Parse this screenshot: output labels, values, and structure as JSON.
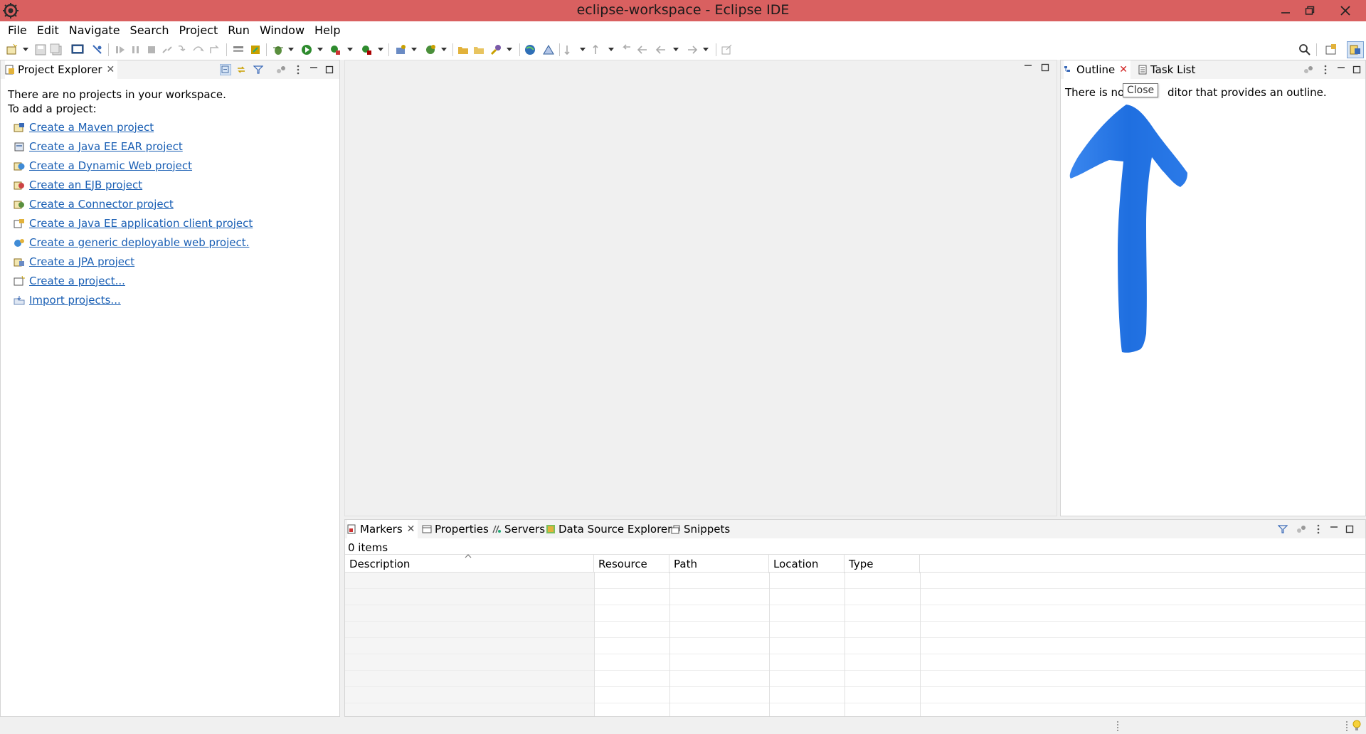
{
  "window": {
    "title": "eclipse-workspace - Eclipse IDE",
    "accent_color": "#d96060"
  },
  "menu": [
    "File",
    "Edit",
    "Navigate",
    "Search",
    "Project",
    "Run",
    "Window",
    "Help"
  ],
  "project_explorer": {
    "tab_label": "Project Explorer",
    "message_line1": "There are no projects in your workspace.",
    "message_line2": "To add a project:",
    "links": [
      {
        "label": "Create a Maven project",
        "icon": "maven-project-icon"
      },
      {
        "label": "Create a Java EE EAR project",
        "icon": "ear-project-icon"
      },
      {
        "label": "Create a Dynamic Web project",
        "icon": "web-project-icon"
      },
      {
        "label": "Create an EJB project",
        "icon": "ejb-project-icon"
      },
      {
        "label": "Create a Connector project",
        "icon": "connector-project-icon"
      },
      {
        "label": "Create a Java EE application client project",
        "icon": "app-client-project-icon"
      },
      {
        "label": "Create a generic deployable web project.",
        "icon": "generic-web-project-icon"
      },
      {
        "label": "Create a JPA project",
        "icon": "jpa-project-icon"
      },
      {
        "label": "Create a project...",
        "icon": "new-project-icon"
      },
      {
        "label": "Import projects...",
        "icon": "import-projects-icon"
      }
    ],
    "link_color": "#1a5fb4"
  },
  "outline": {
    "tab_label": "Outline",
    "task_list_label": "Task List",
    "message_before": "There is no ",
    "message_after": "ditor that provides an outline.",
    "tooltip": "Close"
  },
  "bottom_panel": {
    "tabs": [
      "Markers",
      "Properties",
      "Servers",
      "Data Source Explorer",
      "Snippets"
    ],
    "items_count": "0 items",
    "columns": [
      "Description",
      "Resource",
      "Path",
      "Location",
      "Type"
    ]
  },
  "annotation": {
    "arrow_color": "#1f6fe0"
  }
}
